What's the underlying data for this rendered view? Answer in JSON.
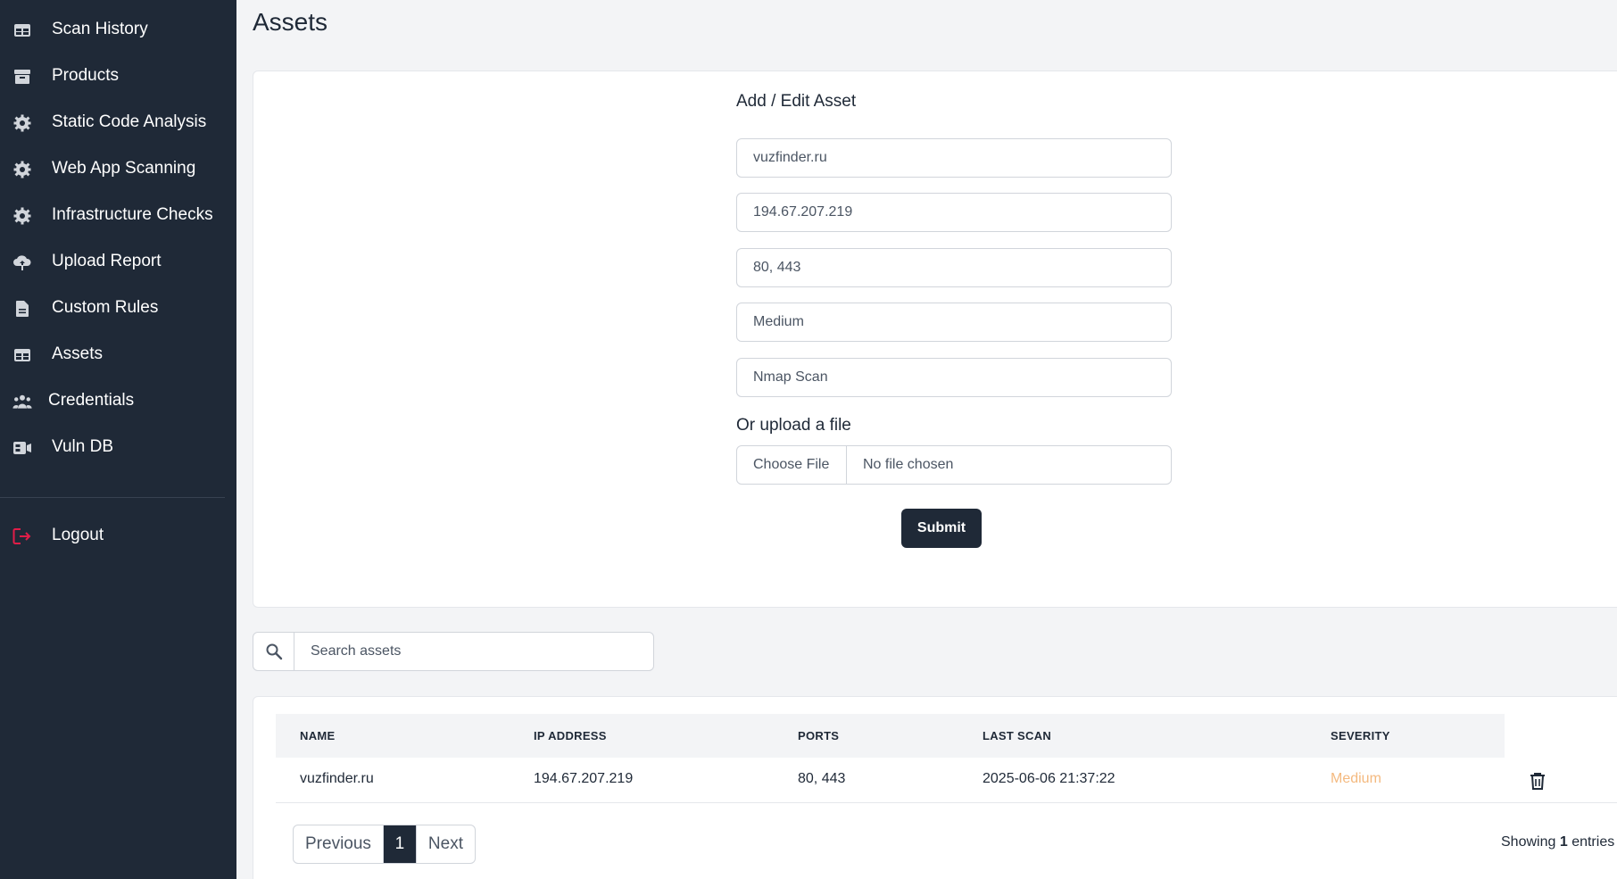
{
  "sidebar": {
    "items": [
      {
        "label": "Scan History",
        "icon": "table-icon"
      },
      {
        "label": "Products",
        "icon": "archive-icon"
      },
      {
        "label": "Static Code Analysis",
        "icon": "gear-icon"
      },
      {
        "label": "Web App Scanning",
        "icon": "gear-icon"
      },
      {
        "label": "Infrastructure Checks",
        "icon": "gear-icon"
      },
      {
        "label": "Upload Report",
        "icon": "cloud-upload-icon"
      },
      {
        "label": "Custom Rules",
        "icon": "document-icon"
      },
      {
        "label": "Assets",
        "icon": "table-icon"
      },
      {
        "label": "Credentials",
        "icon": "users-icon"
      },
      {
        "label": "Vuln DB",
        "icon": "database-icon"
      }
    ],
    "logout": {
      "label": "Logout",
      "icon": "logout-icon",
      "color": "#e11d48"
    }
  },
  "page": {
    "title": "Assets"
  },
  "form": {
    "title": "Add / Edit Asset",
    "name_placeholder": "vuzfinder.ru",
    "ip_placeholder": "194.67.207.219",
    "ports_placeholder": "80, 443",
    "severity_placeholder": "Medium",
    "scan_placeholder": "Nmap Scan",
    "upload_label": "Or upload a file",
    "choose_file": "Choose File",
    "no_file": "No file chosen",
    "submit": "Submit"
  },
  "search": {
    "placeholder": "Search assets"
  },
  "table": {
    "headers": [
      "NAME",
      "IP ADDRESS",
      "PORTS",
      "LAST SCAN",
      "SEVERITY"
    ],
    "rows": [
      {
        "name": "vuzfinder.ru",
        "ip": "194.67.207.219",
        "ports": "80, 443",
        "last_scan": "2025-06-06 21:37:22",
        "severity": "Medium"
      }
    ]
  },
  "pagination": {
    "previous": "Previous",
    "current": "1",
    "next": "Next",
    "showing_prefix": "Showing",
    "showing_count": "1",
    "showing_suffix": "entries"
  },
  "colors": {
    "sidebar_bg": "#1f2937",
    "accent_dark": "#1f2937",
    "severity_medium": "#f4b97f",
    "logout": "#e11d48"
  }
}
